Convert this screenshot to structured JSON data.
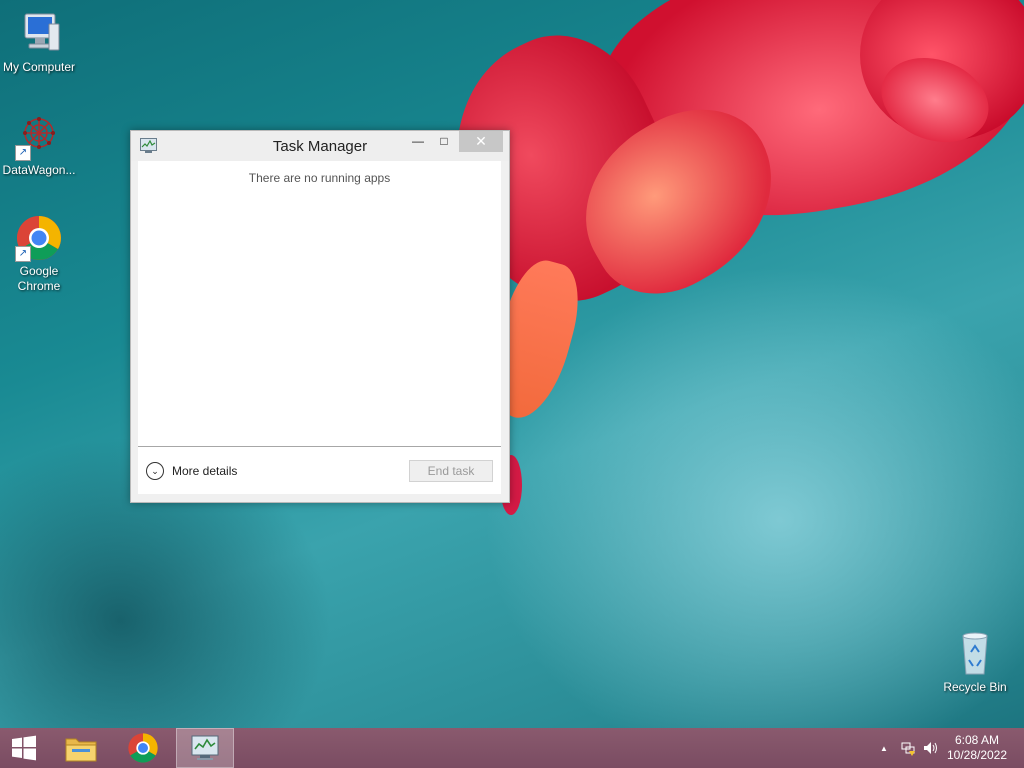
{
  "desktop": {
    "icons": [
      {
        "label": "My Computer"
      },
      {
        "label": "DataWagon..."
      },
      {
        "label": "Google Chrome"
      },
      {
        "label": "Recycle Bin"
      }
    ]
  },
  "task_manager": {
    "title": "Task Manager",
    "empty_message": "There are no running apps",
    "more_details_label": "More details",
    "end_task_label": "End task",
    "minimize_glyph": "—",
    "maximize_glyph": "□",
    "close_glyph": "✕"
  },
  "taskbar": {
    "items": [
      {
        "name": "start-button",
        "icon": "windows-logo-icon"
      },
      {
        "name": "file-explorer",
        "icon": "folder-icon"
      },
      {
        "name": "google-chrome",
        "icon": "chrome-icon"
      },
      {
        "name": "task-manager",
        "icon": "task-manager-icon",
        "active": true
      }
    ],
    "tray": {
      "show_hidden_glyph": "▲",
      "time": "6:08 AM",
      "date": "10/28/2022"
    }
  },
  "colors": {
    "taskbar": "#7a4c62",
    "desktop": "#198a93",
    "flower": "#d0102f"
  }
}
